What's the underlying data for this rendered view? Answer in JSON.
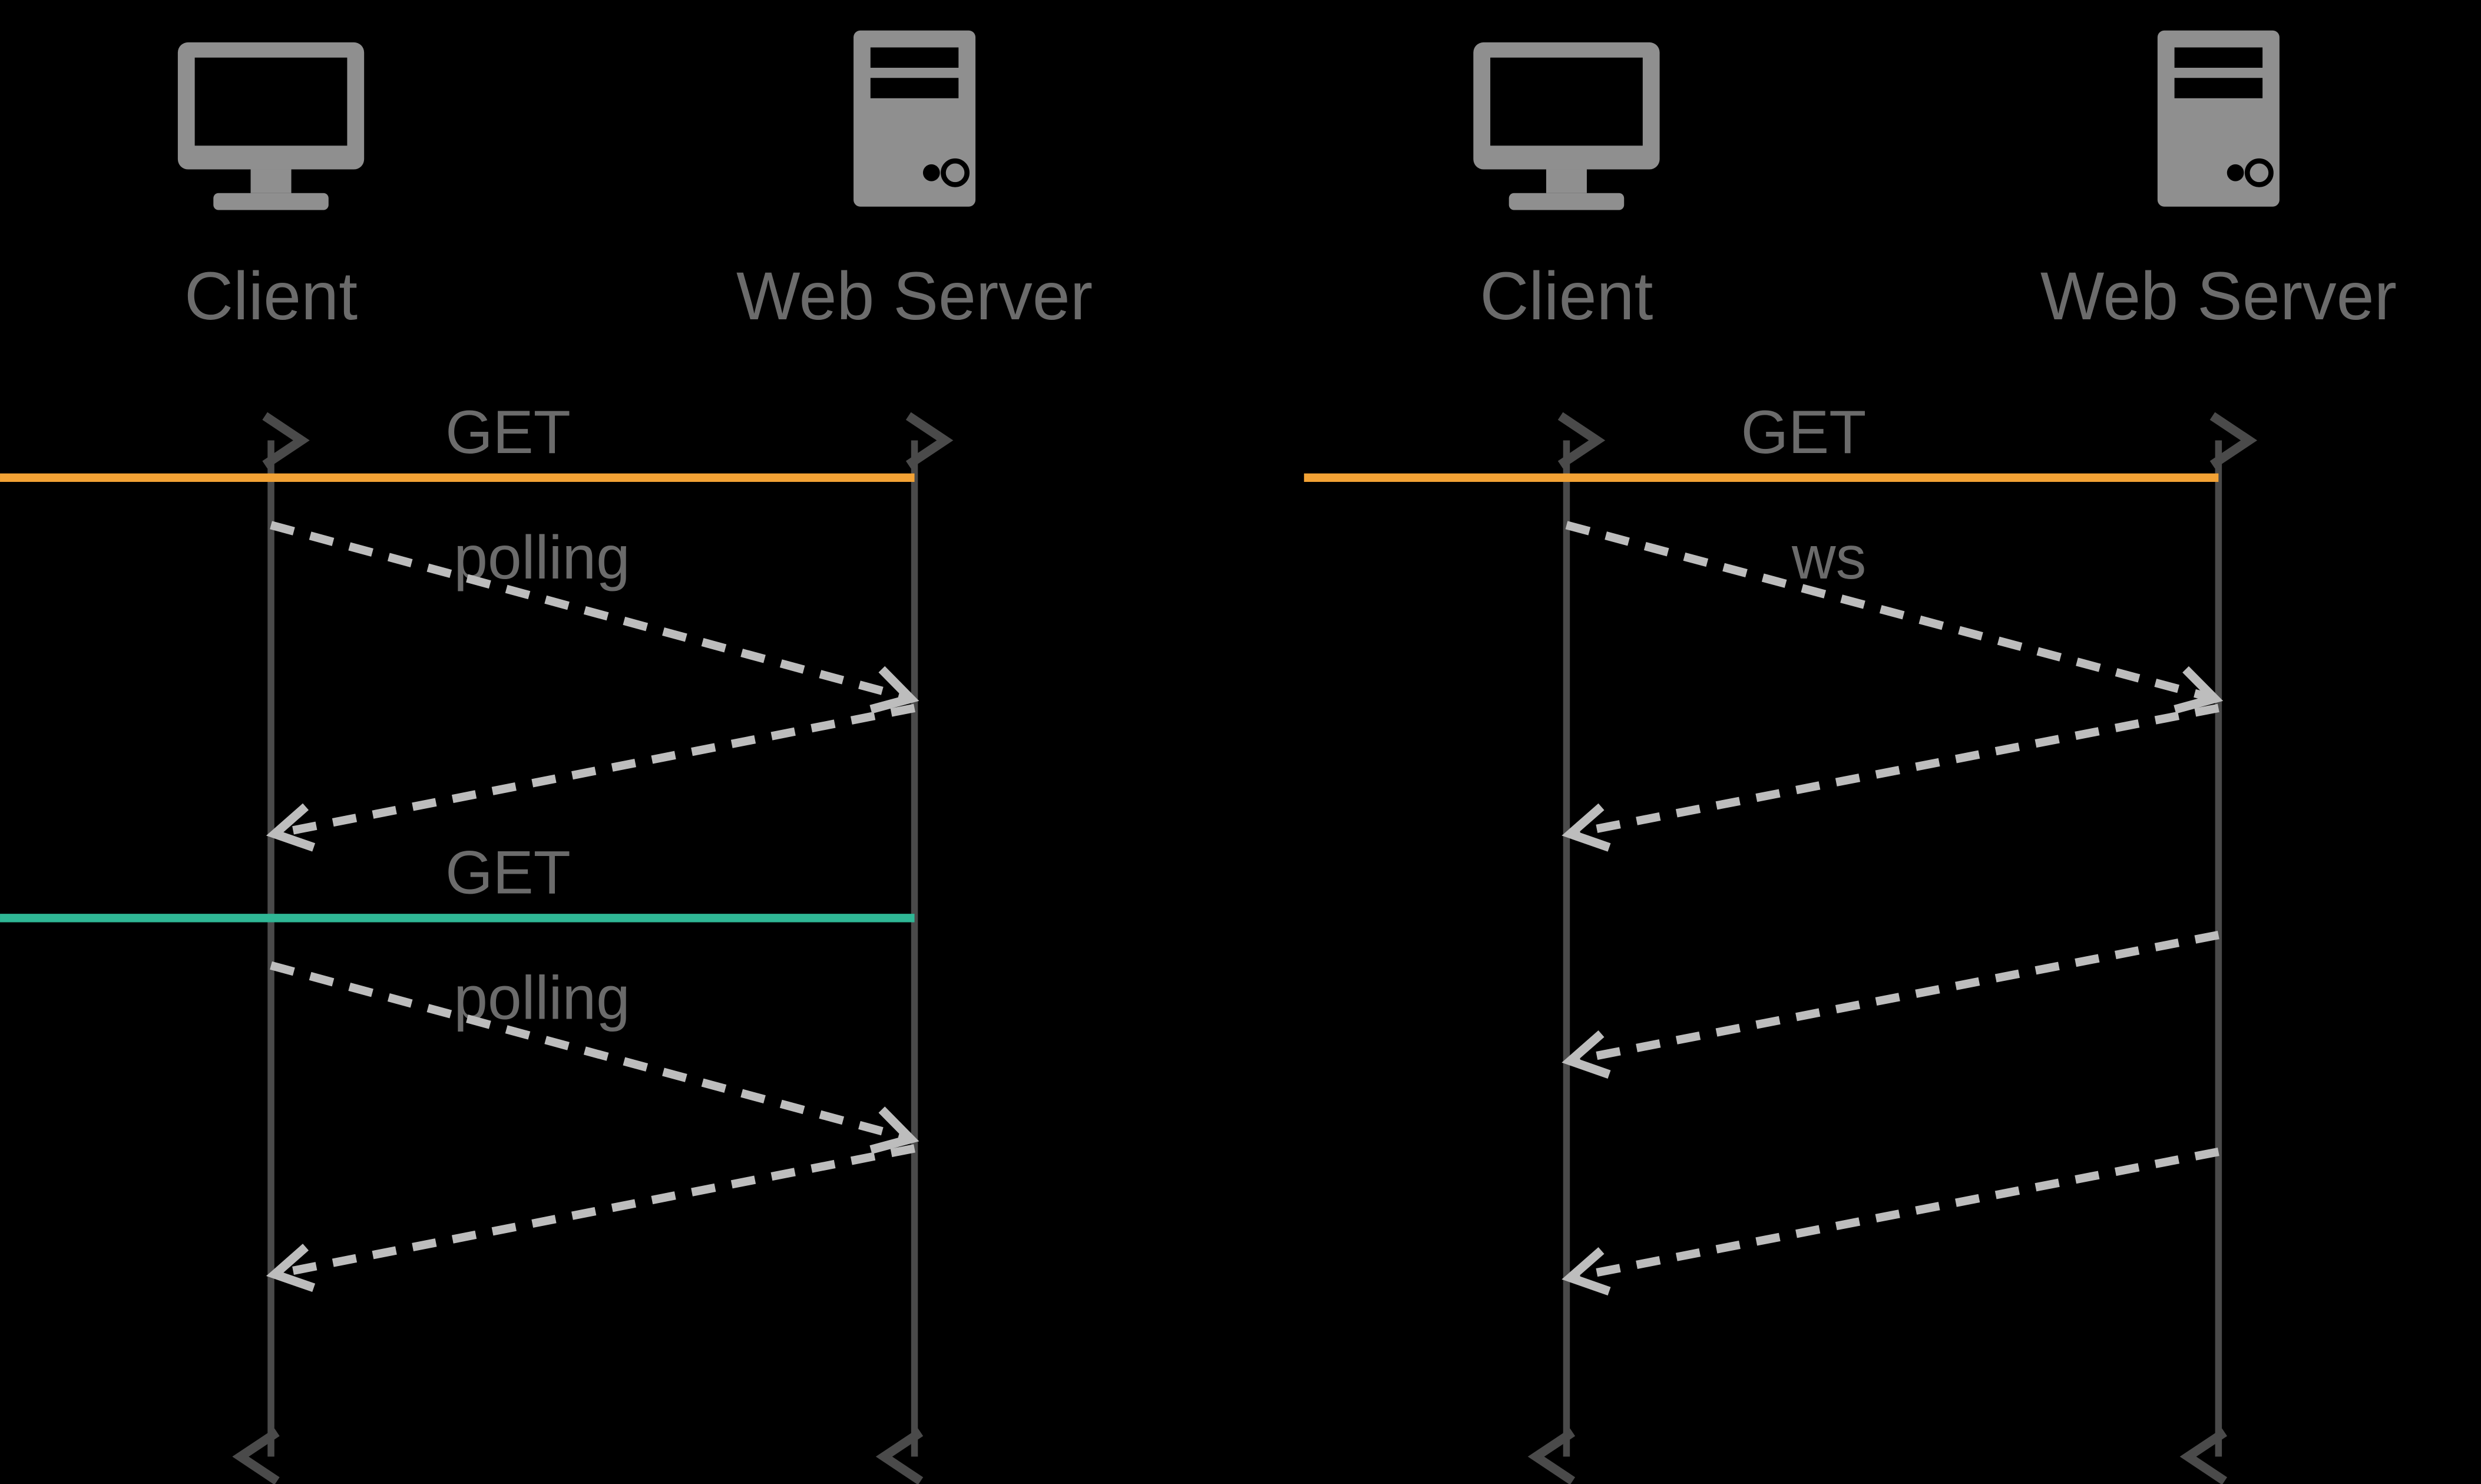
{
  "colors": {
    "orange": "#f2a235",
    "teal": "#2fb795",
    "grey_line": "#4a4a4a",
    "grey_dash": "#bdbdbd",
    "grey_icon": "#8f8f8f",
    "grey_text": "#6b6b6b"
  },
  "left": {
    "client_label": "Client",
    "server_label": "Web Server",
    "messages": {
      "get1": "GET",
      "polling1": "polling",
      "get2": "GET",
      "polling2": "polling"
    }
  },
  "right": {
    "client_label": "Client",
    "server_label": "Web Server",
    "messages": {
      "get": "GET",
      "ws": "ws"
    }
  }
}
